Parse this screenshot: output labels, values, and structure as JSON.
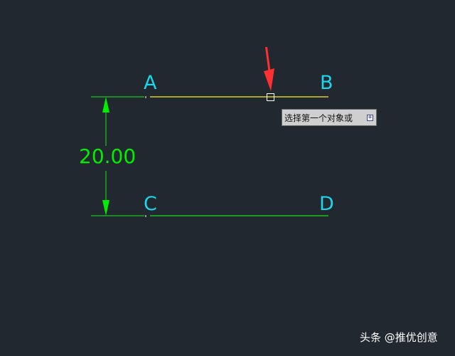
{
  "points": {
    "a": "A",
    "b": "B",
    "c": "C",
    "d": "D"
  },
  "dimension": {
    "value": "20.00"
  },
  "tooltip": {
    "prompt": "选择第一个对象或",
    "expand_symbol": "+"
  },
  "watermark": {
    "text": "头条 @推优创意"
  },
  "colors": {
    "background": "#212830",
    "selected_line": "#d8cc32",
    "line": "#19c319",
    "dimension": "#00ee00",
    "point_label": "#1fd3ea",
    "arrow": "#ff3030",
    "cursor_box": "#ffffff"
  },
  "icons": {
    "cursor": "pickbox-icon",
    "pointer": "red-arrow-icon",
    "expand": "plus-icon"
  }
}
